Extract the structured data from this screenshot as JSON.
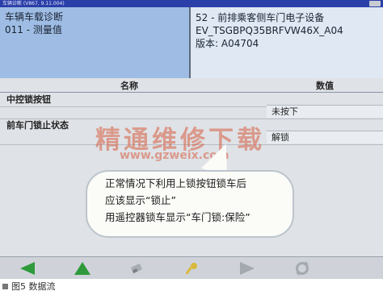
{
  "titlebar": {
    "text": "车辆诊断 (V867, 9.11.004)"
  },
  "header": {
    "left": {
      "line1": "车辆车载诊断",
      "line2": "011 - 测量值"
    },
    "right": {
      "line1": "52 - 前排乘客侧车门电子设备",
      "line2": "EV_TSGBPQ35BRFVW46X_A04",
      "line3": "版本:  A04704"
    }
  },
  "table": {
    "col_name": "名称",
    "col_value": "数值",
    "rows": [
      {
        "name": "中控锁按钮",
        "value": "未按下"
      },
      {
        "name": "前车门锁止状态",
        "value": "解锁"
      }
    ]
  },
  "watermark": {
    "cn": "精通维修下载",
    "url": "www.gzweix.com"
  },
  "callout": {
    "line1": "正常情况下利用上锁按钮锁车后",
    "line2": "应该显示“锁止”",
    "line3": "用遥控器锁车显示“车门锁:保险”"
  },
  "toolbar": {
    "accent": "#2f9a3c",
    "buttons": [
      "arrow-left-icon",
      "arrow-up-icon",
      "eraser-icon",
      "wrench-icon",
      "arrow-right-icon",
      "refresh-icon"
    ]
  },
  "caption": "图5  数据流"
}
